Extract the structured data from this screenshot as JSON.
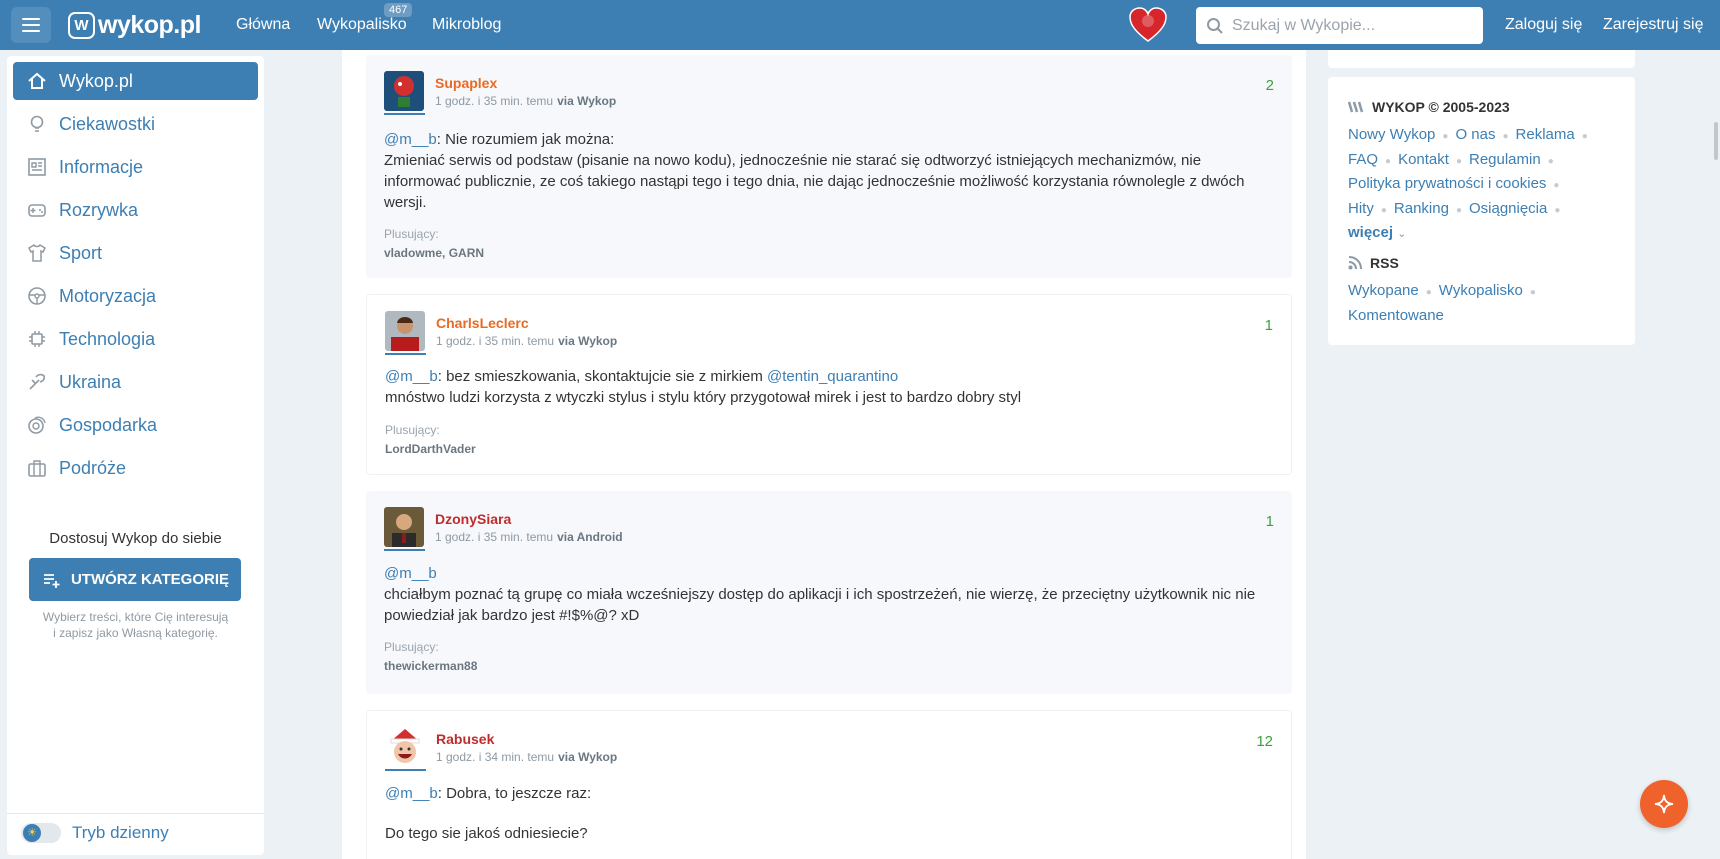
{
  "header": {
    "logo": "wykop.pl",
    "nav": [
      {
        "label": "Główna"
      },
      {
        "label": "Wykopalisko",
        "badge": "467"
      },
      {
        "label": "Mikroblog"
      }
    ],
    "search_placeholder": "Szukaj w Wykopie...",
    "login": "Zaloguj się",
    "register": "Zarejestruj się"
  },
  "sidebar": {
    "items": [
      {
        "label": "Wykop.pl",
        "icon": "home-icon"
      },
      {
        "label": "Ciekawostki",
        "icon": "lightbulb-icon"
      },
      {
        "label": "Informacje",
        "icon": "newspaper-icon"
      },
      {
        "label": "Rozrywka",
        "icon": "gamepad-icon"
      },
      {
        "label": "Sport",
        "icon": "shirt-icon"
      },
      {
        "label": "Motoryzacja",
        "icon": "steering-wheel-icon"
      },
      {
        "label": "Technologia",
        "icon": "chip-icon"
      },
      {
        "label": "Ukraina",
        "icon": "peace-icon"
      },
      {
        "label": "Gospodarka",
        "icon": "coins-icon"
      },
      {
        "label": "Podróże",
        "icon": "suitcase-icon"
      }
    ],
    "custom_title": "Dostosuj Wykop do siebie",
    "custom_button": "UTWÓRZ KATEGORIĘ",
    "custom_help_1": "Wybierz treści, które Cię interesują",
    "custom_help_2": "i zapisz jako Własną kategorię.",
    "day_mode": "Tryb dzienny"
  },
  "entries": [
    {
      "user": "Supaplex",
      "meta": "1 godz. i 35 min. temu",
      "via": "via Wykop",
      "votes": "2",
      "lines": [
        {
          "mention": "@m__b",
          "text": ": Nie rozumiem jak można:"
        },
        {
          "text": "Zmieniać serwis od podstaw (pisanie na nowo kodu), jednocześnie nie starać się odtworzyć istniejących mechanizmów, nie informować publicznie, ze coś takiego nastąpi tego i tego dnia, nie dając jednocześnie możliwość korzystania równolegle z dwóch wersji."
        }
      ],
      "plus_label": "Plusujący:",
      "plus_users": "vladowme, GARN"
    },
    {
      "user": "CharlsLeclerc",
      "meta": "1 godz. i 35 min. temu",
      "via": "via Wykop",
      "votes": "1",
      "line1_mention": "@m__b",
      "line1_text": ": bez smieszkowania, skontaktujcie sie z mirkiem ",
      "line1_mention2": "@tentin_quarantino",
      "line2": "mnóstwo ludzi korzysta z wtyczki stylus i stylu który przygotował mirek i jest to bardzo dobry styl",
      "plus_label": "Plusujący:",
      "plus_users": "LordDarthVader"
    },
    {
      "user": "DzonySiara",
      "meta": "1 godz. i 35 min. temu",
      "via": "via Android",
      "votes": "1",
      "line1_mention": "@m__b",
      "line2": "chciałbym poznać tą grupę co miała wcześniejszy dostęp do aplikacji i ich spostrzeżeń, nie wierzę, że przeciętny użytkownik nic nie powiedział jak bardzo jest #!$%@? xD",
      "plus_label": "Plusujący:",
      "plus_users": "thewickerman88"
    },
    {
      "user": "Rabusek",
      "meta": "1 godz. i 34 min. temu",
      "via": "via Wykop",
      "votes": "12",
      "line1_mention": "@m__b",
      "line1_text": ": Dobra, to jeszcze raz:",
      "line2": "Do tego sie jakoś odniesiecie?"
    }
  ],
  "right": {
    "copyright": "WYKOP © 2005-2023",
    "links": [
      "Nowy Wykop",
      "O nas",
      "Reklama",
      "FAQ",
      "Kontakt",
      "Regulamin",
      "Polityka prywatności i cookies",
      "Hity",
      "Ranking",
      "Osiągnięcia"
    ],
    "more": "więcej",
    "rss_title": "RSS",
    "rss_links": [
      "Wykopane",
      "Wykopalisko",
      "Komentowane"
    ]
  },
  "colors": {
    "brand": "#3d7fb3",
    "accent": "#f0622c",
    "vote": "#3f9e3f"
  }
}
